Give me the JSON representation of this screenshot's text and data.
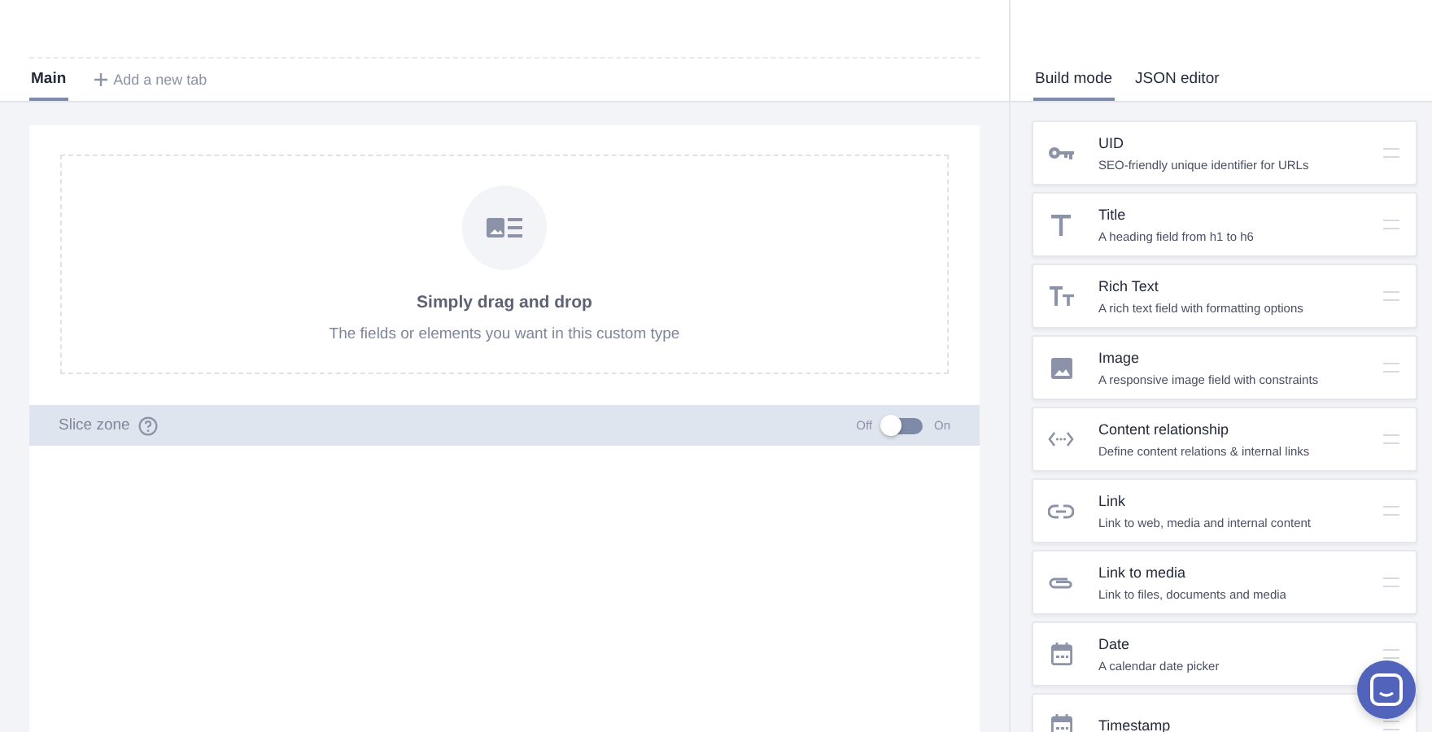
{
  "tabs": [
    {
      "label": "Main",
      "selected": true
    }
  ],
  "add_tab": {
    "label": "Add a new tab"
  },
  "dropzone": {
    "title": "Simply drag and drop",
    "subtitle": "The fields or elements you want in this custom type"
  },
  "slice_zone": {
    "label": "Slice zone",
    "off_label": "Off",
    "on_label": "On",
    "on": false
  },
  "mode_tabs": [
    {
      "label": "Build mode",
      "selected": true
    },
    {
      "label": "JSON editor",
      "selected": false
    }
  ],
  "fields": [
    {
      "kind": "uid",
      "name": "UID",
      "description": "SEO-friendly unique identifier for URLs"
    },
    {
      "kind": "title",
      "name": "Title",
      "description": "A heading field from h1 to h6"
    },
    {
      "kind": "richtext",
      "name": "Rich Text",
      "description": "A rich text field with formatting options"
    },
    {
      "kind": "image",
      "name": "Image",
      "description": "A responsive image field with constraints"
    },
    {
      "kind": "relation",
      "name": "Content relationship",
      "description": "Define content relations & internal links"
    },
    {
      "kind": "link",
      "name": "Link",
      "description": "Link to web, media and internal content"
    },
    {
      "kind": "media",
      "name": "Link to media",
      "description": "Link to files, documents and media"
    },
    {
      "kind": "date",
      "name": "Date",
      "description": "A calendar date picker"
    },
    {
      "kind": "date",
      "name": "Timestamp"
    }
  ]
}
